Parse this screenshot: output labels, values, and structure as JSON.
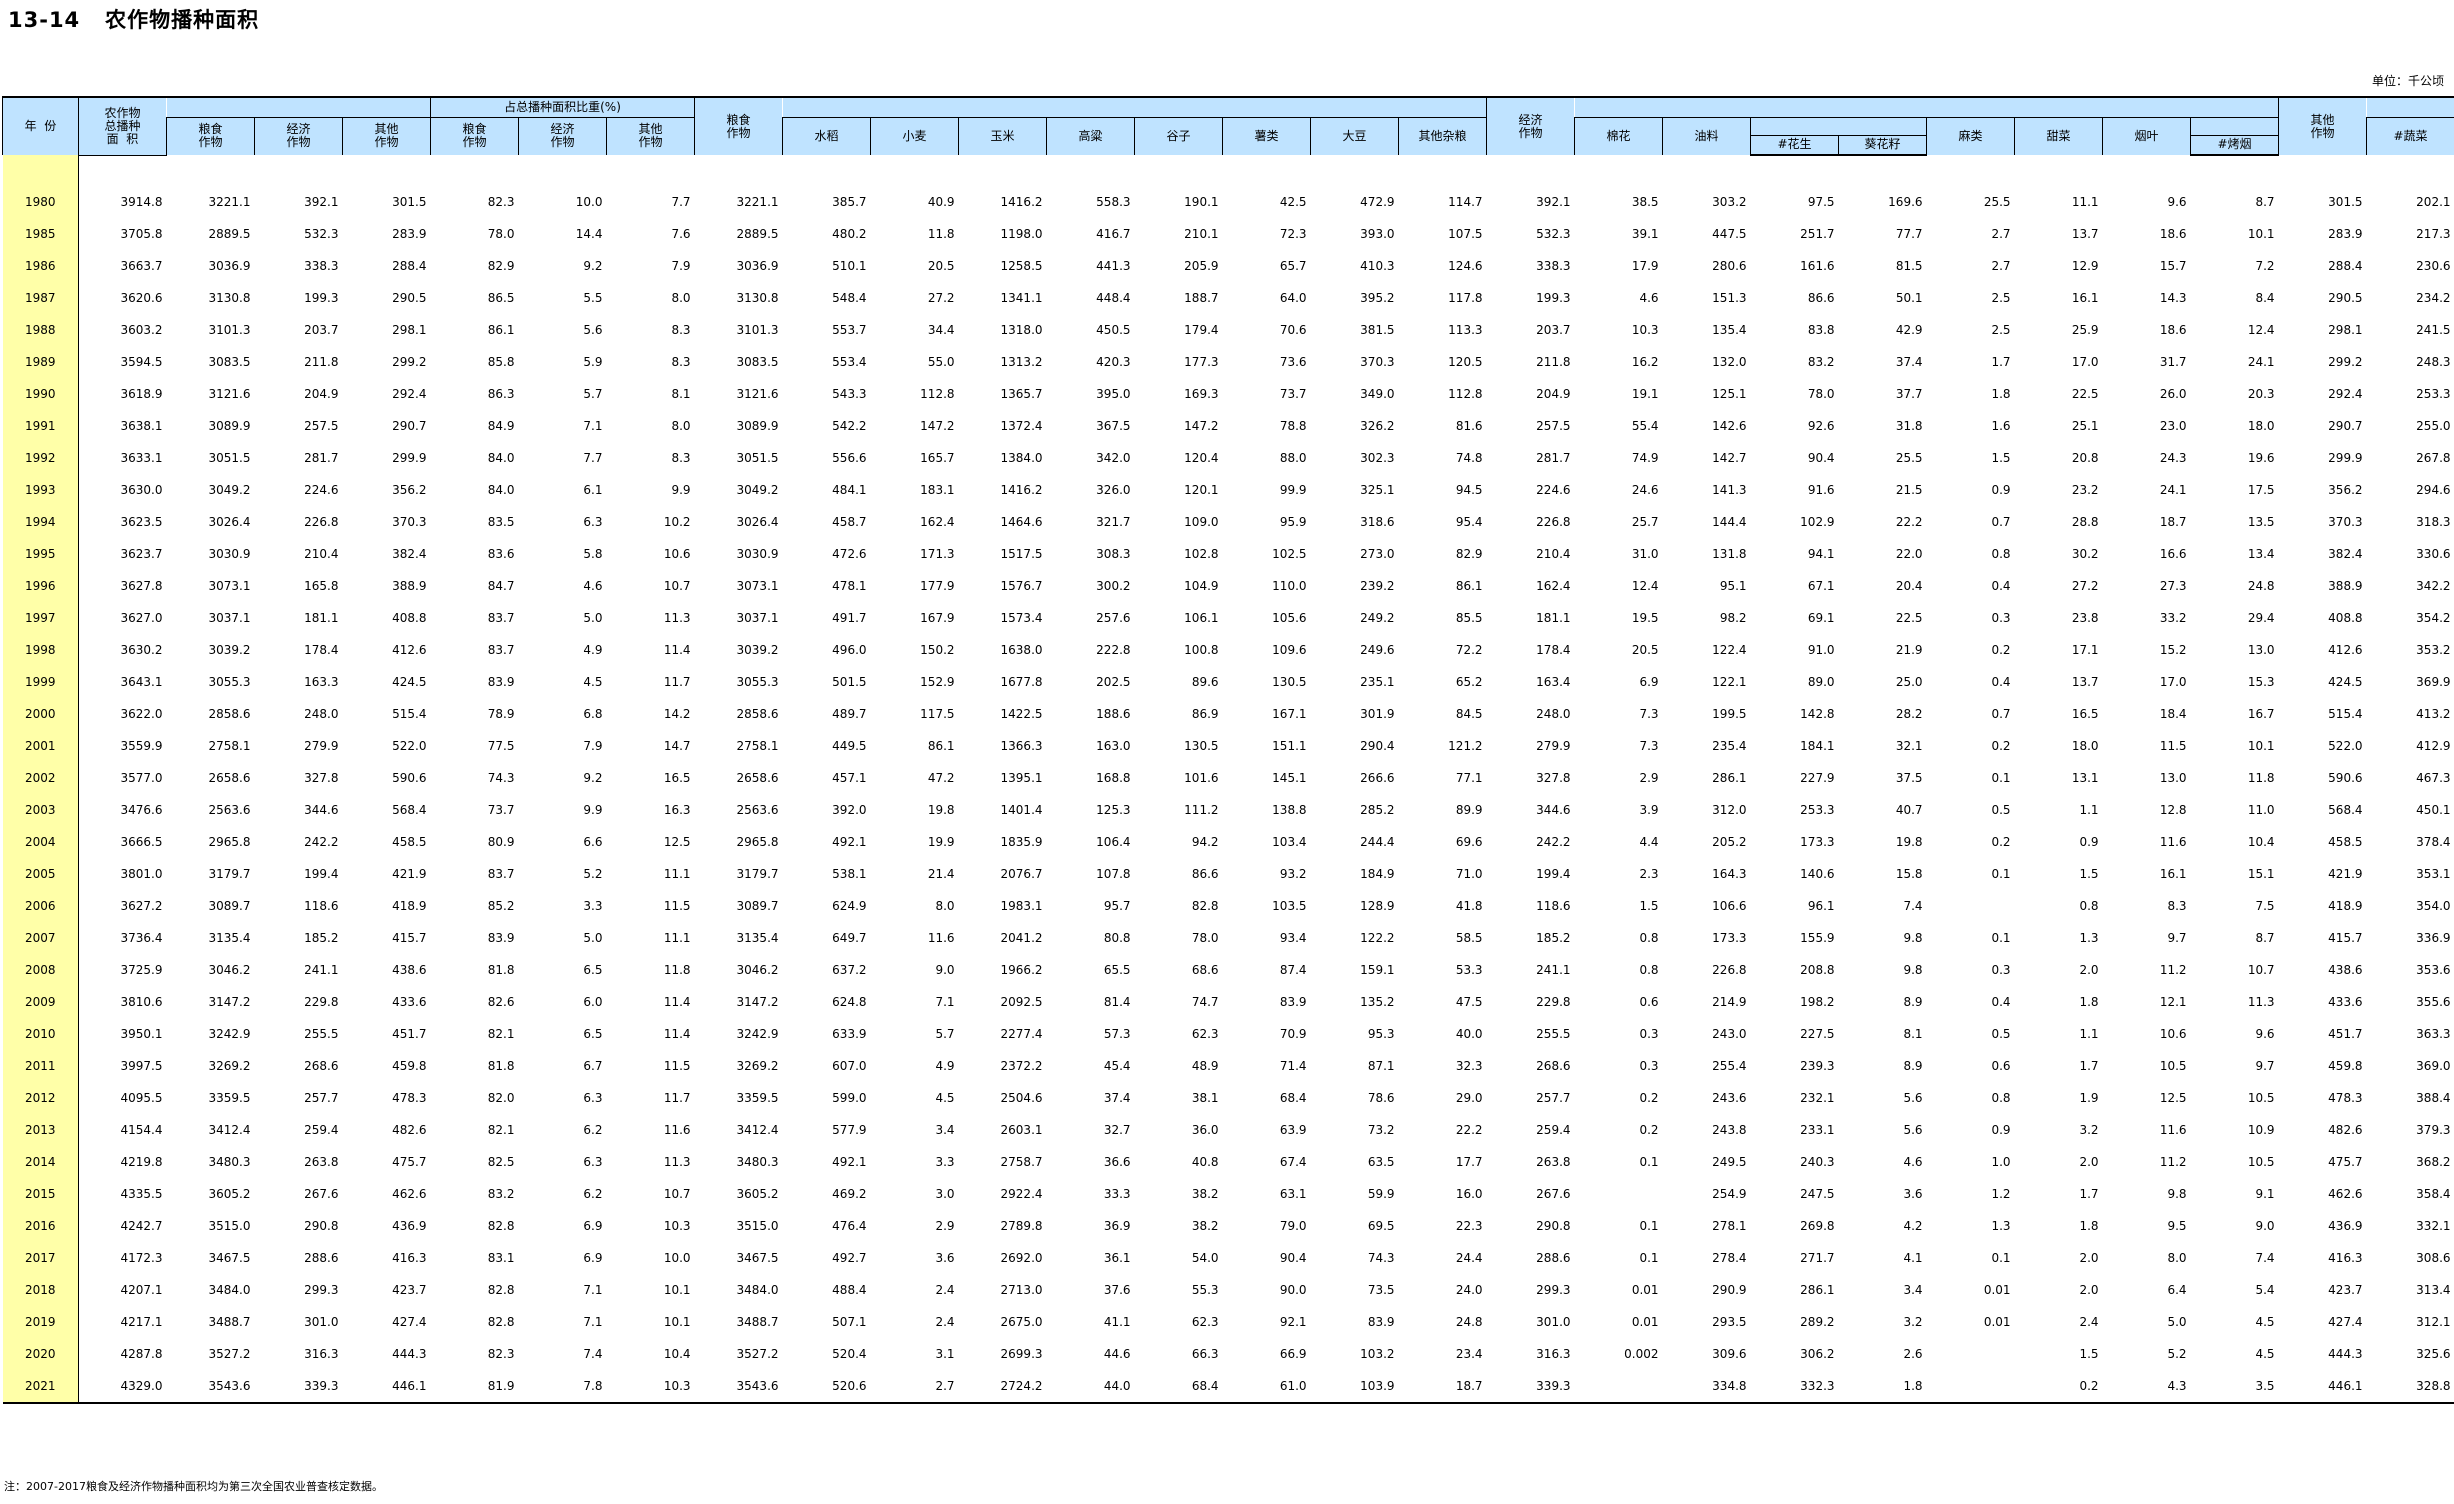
{
  "title": "13-14   农作物播种面积",
  "unit": "单位：千公顷",
  "note": "注：2007-2017粮食及经济作物播种面积均为第三次全国农业普查核定数据。",
  "headers": {
    "year": "年  份",
    "total": "农作物\n总播种\n面  积",
    "grain": "粮食\n作物",
    "econ": "经济\n作物",
    "other": "其他\n作物",
    "share": "占总播种面积比重(%)",
    "share_grain": "粮食\n作物",
    "share_econ": "经济\n作物",
    "share_other": "其他\n作物",
    "grain2": "粮食\n作物",
    "rice": "水稻",
    "wheat": "小麦",
    "corn": "玉米",
    "sorghum": "高粱",
    "millet": "谷子",
    "tubers": "薯类",
    "soybean": "大豆",
    "misc_grain": "其他杂粮",
    "econ2": "经济\n作物",
    "cotton": "棉花",
    "oil": "油料",
    "peanut": "#花生",
    "sunflower": "葵花籽",
    "hemp": "麻类",
    "beet": "甜菜",
    "tobacco": "烟叶",
    "flue_tobacco": "#烤烟",
    "other2": "其他\n作物",
    "vegetables": "#蔬菜"
  },
  "rows": [
    [
      "1980",
      "3914.8",
      "3221.1",
      "392.1",
      "301.5",
      "82.3",
      "10.0",
      "7.7",
      "3221.1",
      "385.7",
      "40.9",
      "1416.2",
      "558.3",
      "190.1",
      "42.5",
      "472.9",
      "114.7",
      "392.1",
      "38.5",
      "303.2",
      "97.5",
      "169.6",
      "25.5",
      "11.1",
      "9.6",
      "8.7",
      "301.5",
      "202.1"
    ],
    [
      "1985",
      "3705.8",
      "2889.5",
      "532.3",
      "283.9",
      "78.0",
      "14.4",
      "7.6",
      "2889.5",
      "480.2",
      "11.8",
      "1198.0",
      "416.7",
      "210.1",
      "72.3",
      "393.0",
      "107.5",
      "532.3",
      "39.1",
      "447.5",
      "251.7",
      "77.7",
      "2.7",
      "13.7",
      "18.6",
      "10.1",
      "283.9",
      "217.3"
    ],
    [
      "1986",
      "3663.7",
      "3036.9",
      "338.3",
      "288.4",
      "82.9",
      "9.2",
      "7.9",
      "3036.9",
      "510.1",
      "20.5",
      "1258.5",
      "441.3",
      "205.9",
      "65.7",
      "410.3",
      "124.6",
      "338.3",
      "17.9",
      "280.6",
      "161.6",
      "81.5",
      "2.7",
      "12.9",
      "15.7",
      "7.2",
      "288.4",
      "230.6"
    ],
    [
      "1987",
      "3620.6",
      "3130.8",
      "199.3",
      "290.5",
      "86.5",
      "5.5",
      "8.0",
      "3130.8",
      "548.4",
      "27.2",
      "1341.1",
      "448.4",
      "188.7",
      "64.0",
      "395.2",
      "117.8",
      "199.3",
      "4.6",
      "151.3",
      "86.6",
      "50.1",
      "2.5",
      "16.1",
      "14.3",
      "8.4",
      "290.5",
      "234.2"
    ],
    [
      "1988",
      "3603.2",
      "3101.3",
      "203.7",
      "298.1",
      "86.1",
      "5.6",
      "8.3",
      "3101.3",
      "553.7",
      "34.4",
      "1318.0",
      "450.5",
      "179.4",
      "70.6",
      "381.5",
      "113.3",
      "203.7",
      "10.3",
      "135.4",
      "83.8",
      "42.9",
      "2.5",
      "25.9",
      "18.6",
      "12.4",
      "298.1",
      "241.5"
    ],
    [
      "1989",
      "3594.5",
      "3083.5",
      "211.8",
      "299.2",
      "85.8",
      "5.9",
      "8.3",
      "3083.5",
      "553.4",
      "55.0",
      "1313.2",
      "420.3",
      "177.3",
      "73.6",
      "370.3",
      "120.5",
      "211.8",
      "16.2",
      "132.0",
      "83.2",
      "37.4",
      "1.7",
      "17.0",
      "31.7",
      "24.1",
      "299.2",
      "248.3"
    ],
    [
      "1990",
      "3618.9",
      "3121.6",
      "204.9",
      "292.4",
      "86.3",
      "5.7",
      "8.1",
      "3121.6",
      "543.3",
      "112.8",
      "1365.7",
      "395.0",
      "169.3",
      "73.7",
      "349.0",
      "112.8",
      "204.9",
      "19.1",
      "125.1",
      "78.0",
      "37.7",
      "1.8",
      "22.5",
      "26.0",
      "20.3",
      "292.4",
      "253.3"
    ],
    [
      "1991",
      "3638.1",
      "3089.9",
      "257.5",
      "290.7",
      "84.9",
      "7.1",
      "8.0",
      "3089.9",
      "542.2",
      "147.2",
      "1372.4",
      "367.5",
      "147.2",
      "78.8",
      "326.2",
      "81.6",
      "257.5",
      "55.4",
      "142.6",
      "92.6",
      "31.8",
      "1.6",
      "25.1",
      "23.0",
      "18.0",
      "290.7",
      "255.0"
    ],
    [
      "1992",
      "3633.1",
      "3051.5",
      "281.7",
      "299.9",
      "84.0",
      "7.7",
      "8.3",
      "3051.5",
      "556.6",
      "165.7",
      "1384.0",
      "342.0",
      "120.4",
      "88.0",
      "302.3",
      "74.8",
      "281.7",
      "74.9",
      "142.7",
      "90.4",
      "25.5",
      "1.5",
      "20.8",
      "24.3",
      "19.6",
      "299.9",
      "267.8"
    ],
    [
      "1993",
      "3630.0",
      "3049.2",
      "224.6",
      "356.2",
      "84.0",
      "6.1",
      "9.9",
      "3049.2",
      "484.1",
      "183.1",
      "1416.2",
      "326.0",
      "120.1",
      "99.9",
      "325.1",
      "94.5",
      "224.6",
      "24.6",
      "141.3",
      "91.6",
      "21.5",
      "0.9",
      "23.2",
      "24.1",
      "17.5",
      "356.2",
      "294.6"
    ],
    [
      "1994",
      "3623.5",
      "3026.4",
      "226.8",
      "370.3",
      "83.5",
      "6.3",
      "10.2",
      "3026.4",
      "458.7",
      "162.4",
      "1464.6",
      "321.7",
      "109.0",
      "95.9",
      "318.6",
      "95.4",
      "226.8",
      "25.7",
      "144.4",
      "102.9",
      "22.2",
      "0.7",
      "28.8",
      "18.7",
      "13.5",
      "370.3",
      "318.3"
    ],
    [
      "1995",
      "3623.7",
      "3030.9",
      "210.4",
      "382.4",
      "83.6",
      "5.8",
      "10.6",
      "3030.9",
      "472.6",
      "171.3",
      "1517.5",
      "308.3",
      "102.8",
      "102.5",
      "273.0",
      "82.9",
      "210.4",
      "31.0",
      "131.8",
      "94.1",
      "22.0",
      "0.8",
      "30.2",
      "16.6",
      "13.4",
      "382.4",
      "330.6"
    ],
    [
      "1996",
      "3627.8",
      "3073.1",
      "165.8",
      "388.9",
      "84.7",
      "4.6",
      "10.7",
      "3073.1",
      "478.1",
      "177.9",
      "1576.7",
      "300.2",
      "104.9",
      "110.0",
      "239.2",
      "86.1",
      "162.4",
      "12.4",
      "95.1",
      "67.1",
      "20.4",
      "0.4",
      "27.2",
      "27.3",
      "24.8",
      "388.9",
      "342.2"
    ],
    [
      "1997",
      "3627.0",
      "3037.1",
      "181.1",
      "408.8",
      "83.7",
      "5.0",
      "11.3",
      "3037.1",
      "491.7",
      "167.9",
      "1573.4",
      "257.6",
      "106.1",
      "105.6",
      "249.2",
      "85.5",
      "181.1",
      "19.5",
      "98.2",
      "69.1",
      "22.5",
      "0.3",
      "23.8",
      "33.2",
      "29.4",
      "408.8",
      "354.2"
    ],
    [
      "1998",
      "3630.2",
      "3039.2",
      "178.4",
      "412.6",
      "83.7",
      "4.9",
      "11.4",
      "3039.2",
      "496.0",
      "150.2",
      "1638.0",
      "222.8",
      "100.8",
      "109.6",
      "249.6",
      "72.2",
      "178.4",
      "20.5",
      "122.4",
      "91.0",
      "21.9",
      "0.2",
      "17.1",
      "15.2",
      "13.0",
      "412.6",
      "353.2"
    ],
    [
      "1999",
      "3643.1",
      "3055.3",
      "163.3",
      "424.5",
      "83.9",
      "4.5",
      "11.7",
      "3055.3",
      "501.5",
      "152.9",
      "1677.8",
      "202.5",
      "89.6",
      "130.5",
      "235.1",
      "65.2",
      "163.4",
      "6.9",
      "122.1",
      "89.0",
      "25.0",
      "0.4",
      "13.7",
      "17.0",
      "15.3",
      "424.5",
      "369.9"
    ],
    [
      "2000",
      "3622.0",
      "2858.6",
      "248.0",
      "515.4",
      "78.9",
      "6.8",
      "14.2",
      "2858.6",
      "489.7",
      "117.5",
      "1422.5",
      "188.6",
      "86.9",
      "167.1",
      "301.9",
      "84.5",
      "248.0",
      "7.3",
      "199.5",
      "142.8",
      "28.2",
      "0.7",
      "16.5",
      "18.4",
      "16.7",
      "515.4",
      "413.2"
    ],
    [
      "2001",
      "3559.9",
      "2758.1",
      "279.9",
      "522.0",
      "77.5",
      "7.9",
      "14.7",
      "2758.1",
      "449.5",
      "86.1",
      "1366.3",
      "163.0",
      "130.5",
      "151.1",
      "290.4",
      "121.2",
      "279.9",
      "7.3",
      "235.4",
      "184.1",
      "32.1",
      "0.2",
      "18.0",
      "11.5",
      "10.1",
      "522.0",
      "412.9"
    ],
    [
      "2002",
      "3577.0",
      "2658.6",
      "327.8",
      "590.6",
      "74.3",
      "9.2",
      "16.5",
      "2658.6",
      "457.1",
      "47.2",
      "1395.1",
      "168.8",
      "101.6",
      "145.1",
      "266.6",
      "77.1",
      "327.8",
      "2.9",
      "286.1",
      "227.9",
      "37.5",
      "0.1",
      "13.1",
      "13.0",
      "11.8",
      "590.6",
      "467.3"
    ],
    [
      "2003",
      "3476.6",
      "2563.6",
      "344.6",
      "568.4",
      "73.7",
      "9.9",
      "16.3",
      "2563.6",
      "392.0",
      "19.8",
      "1401.4",
      "125.3",
      "111.2",
      "138.8",
      "285.2",
      "89.9",
      "344.6",
      "3.9",
      "312.0",
      "253.3",
      "40.7",
      "0.5",
      "1.1",
      "12.8",
      "11.0",
      "568.4",
      "450.1"
    ],
    [
      "2004",
      "3666.5",
      "2965.8",
      "242.2",
      "458.5",
      "80.9",
      "6.6",
      "12.5",
      "2965.8",
      "492.1",
      "19.9",
      "1835.9",
      "106.4",
      "94.2",
      "103.4",
      "244.4",
      "69.6",
      "242.2",
      "4.4",
      "205.2",
      "173.3",
      "19.8",
      "0.2",
      "0.9",
      "11.6",
      "10.4",
      "458.5",
      "378.4"
    ],
    [
      "2005",
      "3801.0",
      "3179.7",
      "199.4",
      "421.9",
      "83.7",
      "5.2",
      "11.1",
      "3179.7",
      "538.1",
      "21.4",
      "2076.7",
      "107.8",
      "86.6",
      "93.2",
      "184.9",
      "71.0",
      "199.4",
      "2.3",
      "164.3",
      "140.6",
      "15.8",
      "0.1",
      "1.5",
      "16.1",
      "15.1",
      "421.9",
      "353.1"
    ],
    [
      "2006",
      "3627.2",
      "3089.7",
      "118.6",
      "418.9",
      "85.2",
      "3.3",
      "11.5",
      "3089.7",
      "624.9",
      "8.0",
      "1983.1",
      "95.7",
      "82.8",
      "103.5",
      "128.9",
      "41.8",
      "118.6",
      "1.5",
      "106.6",
      "96.1",
      "7.4",
      "",
      "0.8",
      "8.3",
      "7.5",
      "418.9",
      "354.0"
    ],
    [
      "2007",
      "3736.4",
      "3135.4",
      "185.2",
      "415.7",
      "83.9",
      "5.0",
      "11.1",
      "3135.4",
      "649.7",
      "11.6",
      "2041.2",
      "80.8",
      "78.0",
      "93.4",
      "122.2",
      "58.5",
      "185.2",
      "0.8",
      "173.3",
      "155.9",
      "9.8",
      "0.1",
      "1.3",
      "9.7",
      "8.7",
      "415.7",
      "336.9"
    ],
    [
      "2008",
      "3725.9",
      "3046.2",
      "241.1",
      "438.6",
      "81.8",
      "6.5",
      "11.8",
      "3046.2",
      "637.2",
      "9.0",
      "1966.2",
      "65.5",
      "68.6",
      "87.4",
      "159.1",
      "53.3",
      "241.1",
      "0.8",
      "226.8",
      "208.8",
      "9.8",
      "0.3",
      "2.0",
      "11.2",
      "10.7",
      "438.6",
      "353.6"
    ],
    [
      "2009",
      "3810.6",
      "3147.2",
      "229.8",
      "433.6",
      "82.6",
      "6.0",
      "11.4",
      "3147.2",
      "624.8",
      "7.1",
      "2092.5",
      "81.4",
      "74.7",
      "83.9",
      "135.2",
      "47.5",
      "229.8",
      "0.6",
      "214.9",
      "198.2",
      "8.9",
      "0.4",
      "1.8",
      "12.1",
      "11.3",
      "433.6",
      "355.6"
    ],
    [
      "2010",
      "3950.1",
      "3242.9",
      "255.5",
      "451.7",
      "82.1",
      "6.5",
      "11.4",
      "3242.9",
      "633.9",
      "5.7",
      "2277.4",
      "57.3",
      "62.3",
      "70.9",
      "95.3",
      "40.0",
      "255.5",
      "0.3",
      "243.0",
      "227.5",
      "8.1",
      "0.5",
      "1.1",
      "10.6",
      "9.6",
      "451.7",
      "363.3"
    ],
    [
      "2011",
      "3997.5",
      "3269.2",
      "268.6",
      "459.8",
      "81.8",
      "6.7",
      "11.5",
      "3269.2",
      "607.0",
      "4.9",
      "2372.2",
      "45.4",
      "48.9",
      "71.4",
      "87.1",
      "32.3",
      "268.6",
      "0.3",
      "255.4",
      "239.3",
      "8.9",
      "0.6",
      "1.7",
      "10.5",
      "9.7",
      "459.8",
      "369.0"
    ],
    [
      "2012",
      "4095.5",
      "3359.5",
      "257.7",
      "478.3",
      "82.0",
      "6.3",
      "11.7",
      "3359.5",
      "599.0",
      "4.5",
      "2504.6",
      "37.4",
      "38.1",
      "68.4",
      "78.6",
      "29.0",
      "257.7",
      "0.2",
      "243.6",
      "232.1",
      "5.6",
      "0.8",
      "1.9",
      "12.5",
      "10.5",
      "478.3",
      "388.4"
    ],
    [
      "2013",
      "4154.4",
      "3412.4",
      "259.4",
      "482.6",
      "82.1",
      "6.2",
      "11.6",
      "3412.4",
      "577.9",
      "3.4",
      "2603.1",
      "32.7",
      "36.0",
      "63.9",
      "73.2",
      "22.2",
      "259.4",
      "0.2",
      "243.8",
      "233.1",
      "5.6",
      "0.9",
      "3.2",
      "11.6",
      "10.9",
      "482.6",
      "379.3"
    ],
    [
      "2014",
      "4219.8",
      "3480.3",
      "263.8",
      "475.7",
      "82.5",
      "6.3",
      "11.3",
      "3480.3",
      "492.1",
      "3.3",
      "2758.7",
      "36.6",
      "40.8",
      "67.4",
      "63.5",
      "17.7",
      "263.8",
      "0.1",
      "249.5",
      "240.3",
      "4.6",
      "1.0",
      "2.0",
      "11.2",
      "10.5",
      "475.7",
      "368.2"
    ],
    [
      "2015",
      "4335.5",
      "3605.2",
      "267.6",
      "462.6",
      "83.2",
      "6.2",
      "10.7",
      "3605.2",
      "469.2",
      "3.0",
      "2922.4",
      "33.3",
      "38.2",
      "63.1",
      "59.9",
      "16.0",
      "267.6",
      "",
      "254.9",
      "247.5",
      "3.6",
      "1.2",
      "1.7",
      "9.8",
      "9.1",
      "462.6",
      "358.4"
    ],
    [
      "2016",
      "4242.7",
      "3515.0",
      "290.8",
      "436.9",
      "82.8",
      "6.9",
      "10.3",
      "3515.0",
      "476.4",
      "2.9",
      "2789.8",
      "36.9",
      "38.2",
      "79.0",
      "69.5",
      "22.3",
      "290.8",
      "0.1",
      "278.1",
      "269.8",
      "4.2",
      "1.3",
      "1.8",
      "9.5",
      "9.0",
      "436.9",
      "332.1"
    ],
    [
      "2017",
      "4172.3",
      "3467.5",
      "288.6",
      "416.3",
      "83.1",
      "6.9",
      "10.0",
      "3467.5",
      "492.7",
      "3.6",
      "2692.0",
      "36.1",
      "54.0",
      "90.4",
      "74.3",
      "24.4",
      "288.6",
      "0.1",
      "278.4",
      "271.7",
      "4.1",
      "0.1",
      "2.0",
      "8.0",
      "7.4",
      "416.3",
      "308.6"
    ],
    [
      "2018",
      "4207.1",
      "3484.0",
      "299.3",
      "423.7",
      "82.8",
      "7.1",
      "10.1",
      "3484.0",
      "488.4",
      "2.4",
      "2713.0",
      "37.6",
      "55.3",
      "90.0",
      "73.5",
      "24.0",
      "299.3",
      "0.01",
      "290.9",
      "286.1",
      "3.4",
      "0.01",
      "2.0",
      "6.4",
      "5.4",
      "423.7",
      "313.4"
    ],
    [
      "2019",
      "4217.1",
      "3488.7",
      "301.0",
      "427.4",
      "82.8",
      "7.1",
      "10.1",
      "3488.7",
      "507.1",
      "2.4",
      "2675.0",
      "41.1",
      "62.3",
      "92.1",
      "83.9",
      "24.8",
      "301.0",
      "0.01",
      "293.5",
      "289.2",
      "3.2",
      "0.01",
      "2.4",
      "5.0",
      "4.5",
      "427.4",
      "312.1"
    ],
    [
      "2020",
      "4287.8",
      "3527.2",
      "316.3",
      "444.3",
      "82.3",
      "7.4",
      "10.4",
      "3527.2",
      "520.4",
      "3.1",
      "2699.3",
      "44.6",
      "66.3",
      "66.9",
      "103.2",
      "23.4",
      "316.3",
      "0.002",
      "309.6",
      "306.2",
      "2.6",
      "",
      "1.5",
      "5.2",
      "4.5",
      "444.3",
      "325.6"
    ],
    [
      "2021",
      "4329.0",
      "3543.6",
      "339.3",
      "446.1",
      "81.9",
      "7.8",
      "10.3",
      "3543.6",
      "520.6",
      "2.7",
      "2724.2",
      "44.0",
      "68.4",
      "61.0",
      "103.9",
      "18.7",
      "339.3",
      "",
      "334.8",
      "332.3",
      "1.8",
      "",
      "0.2",
      "4.3",
      "3.5",
      "446.1",
      "328.8"
    ]
  ]
}
